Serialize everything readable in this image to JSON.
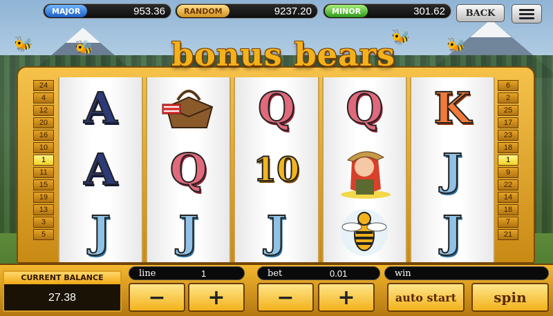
{
  "jackpots": {
    "major": {
      "label": "MAJOR",
      "value": "953.36"
    },
    "random": {
      "label": "RANDOM",
      "value": "9237.20"
    },
    "minor": {
      "label": "MINOR",
      "value": "301.62"
    }
  },
  "header": {
    "back_label": "BACK",
    "menu_icon": "hamburger-menu-icon"
  },
  "logo_text": "bonus bears",
  "paylines": {
    "left": [
      "24",
      "4",
      "12",
      "20",
      "16",
      "10",
      "1",
      "11",
      "15",
      "19",
      "13",
      "3",
      "5"
    ],
    "right": [
      "6",
      "2",
      "25",
      "17",
      "23",
      "18",
      "1",
      "9",
      "22",
      "14",
      "18",
      "7",
      "21"
    ]
  },
  "reels": [
    [
      {
        "symbol": "A"
      },
      {
        "symbol": "A"
      },
      {
        "symbol": "J"
      }
    ],
    [
      {
        "symbol": "picnic-basket"
      },
      {
        "symbol": "Q"
      },
      {
        "symbol": "J"
      }
    ],
    [
      {
        "symbol": "Q"
      },
      {
        "symbol": "10"
      },
      {
        "symbol": "J"
      }
    ],
    [
      {
        "symbol": "Q"
      },
      {
        "symbol": "ranger-girl"
      },
      {
        "symbol": "bee"
      }
    ],
    [
      {
        "symbol": "K"
      },
      {
        "symbol": "J"
      },
      {
        "symbol": "J"
      }
    ]
  ],
  "balance": {
    "label": "CURRENT BALANCE",
    "value": "27.38"
  },
  "controls": {
    "line_label": "line",
    "line_value": "1",
    "bet_label": "bet",
    "bet_value": "0.01",
    "win_label": "win",
    "win_value": "",
    "minus": "−",
    "plus": "+",
    "auto_start": "auto start",
    "spin": "spin"
  },
  "colors": {
    "frame": "#f3b21c",
    "active_line": "#fff48a",
    "accent": "#7a3e00"
  }
}
